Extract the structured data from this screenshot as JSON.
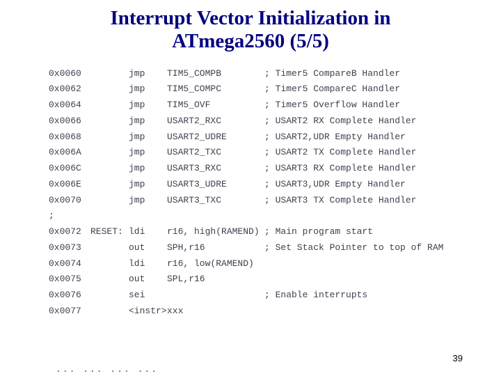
{
  "title_line1": "Interrupt Vector Initialization in",
  "title_line2": "ATmega2560 (5/5)",
  "page_number": "39",
  "ellipses": "...   ...   ...   ...",
  "rows": [
    {
      "addr": "0x0060",
      "label": "",
      "instr": "jmp",
      "oper": "TIM5_COMPB",
      "cmt": "; Timer5 CompareB Handler"
    },
    {
      "addr": "0x0062",
      "label": "",
      "instr": "jmp",
      "oper": "TIM5_COMPC",
      "cmt": "; Timer5 CompareC Handler"
    },
    {
      "addr": "0x0064",
      "label": "",
      "instr": "jmp",
      "oper": "TIM5_OVF",
      "cmt": "; Timer5 Overflow Handler"
    },
    {
      "addr": "0x0066",
      "label": "",
      "instr": "jmp",
      "oper": "USART2_RXC",
      "cmt": "; USART2 RX Complete Handler"
    },
    {
      "addr": "0x0068",
      "label": "",
      "instr": "jmp",
      "oper": "USART2_UDRE",
      "cmt": "; USART2,UDR Empty Handler"
    },
    {
      "addr": "0x006A",
      "label": "",
      "instr": "jmp",
      "oper": "USART2_TXC",
      "cmt": "; USART2 TX Complete Handler"
    },
    {
      "addr": "0x006C",
      "label": "",
      "instr": "jmp",
      "oper": "USART3_RXC",
      "cmt": "; USART3 RX Complete Handler"
    },
    {
      "addr": "0x006E",
      "label": "",
      "instr": "jmp",
      "oper": "USART3_UDRE",
      "cmt": "; USART3,UDR Empty Handler"
    },
    {
      "addr": "0x0070",
      "label": "",
      "instr": "jmp",
      "oper": "USART3_TXC",
      "cmt": "; USART3 TX Complete Handler"
    },
    {
      "addr": ";",
      "label": "",
      "instr": "",
      "oper": "",
      "cmt": ""
    },
    {
      "addr": "0x0072",
      "label": "RESET:",
      "instr": "ldi",
      "oper": "r16, high(RAMEND)",
      "cmt": "; Main program start"
    },
    {
      "addr": "0x0073",
      "label": "",
      "instr": "out",
      "oper": "SPH,r16",
      "cmt": "; Set Stack Pointer to top of RAM"
    },
    {
      "addr": "0x0074",
      "label": "",
      "instr": "ldi",
      "oper": "r16, low(RAMEND)",
      "cmt": ""
    },
    {
      "addr": "0x0075",
      "label": "",
      "instr": "out",
      "oper": "SPL,r16",
      "cmt": ""
    },
    {
      "addr": "0x0076",
      "label": "",
      "instr": "sei",
      "oper": "",
      "cmt": "; Enable interrupts"
    },
    {
      "addr": "0x0077",
      "label": "",
      "instr": "<instr>",
      "oper": "xxx",
      "cmt": ""
    }
  ]
}
